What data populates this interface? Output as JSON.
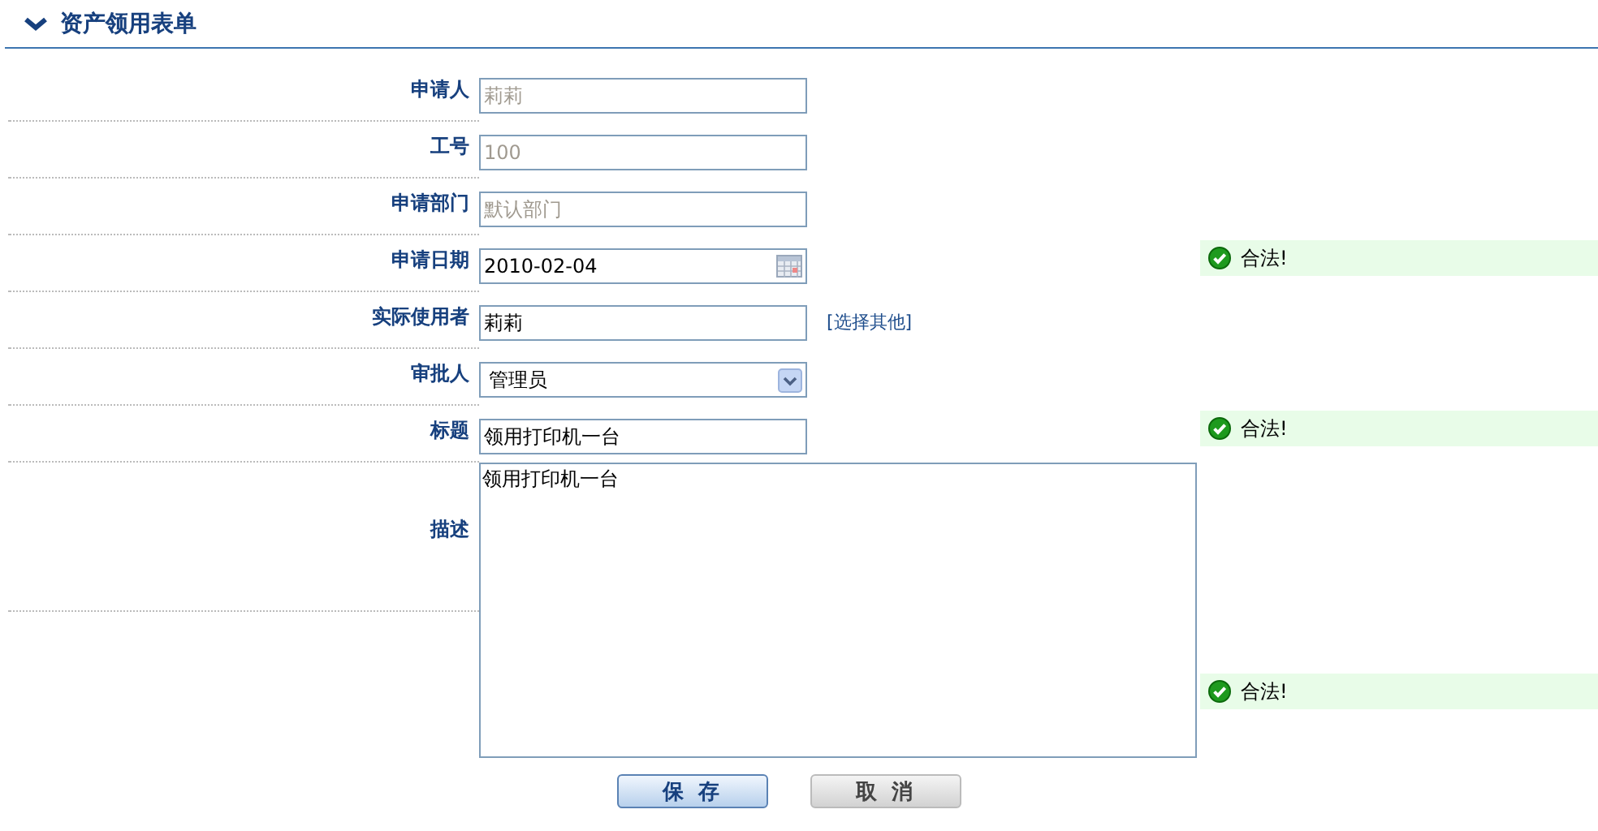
{
  "header": {
    "title": "资产领用表单"
  },
  "fields": [
    {
      "label": "申请人",
      "kind": "input",
      "value": "莉莉",
      "disabled": true
    },
    {
      "label": "工号",
      "kind": "input",
      "value": "100",
      "disabled": true
    },
    {
      "label": "申请部门",
      "kind": "input",
      "value": "默认部门",
      "disabled": true
    },
    {
      "label": "申请日期",
      "kind": "date",
      "value": "2010-02-04",
      "disabled": false,
      "message": "合法!"
    },
    {
      "label": "实际使用者",
      "kind": "input",
      "value": "莉莉",
      "disabled": false,
      "link": "[选择其他]"
    },
    {
      "label": "审批人",
      "kind": "select",
      "value": "管理员",
      "disabled": false
    },
    {
      "label": "标题",
      "kind": "input",
      "value": "领用打印机一台",
      "disabled": false,
      "message": "合法!"
    },
    {
      "label": "描述",
      "kind": "textarea",
      "value": "领用打印机一台",
      "disabled": false,
      "message": "合法!"
    }
  ],
  "buttons": [
    {
      "label": "保 存",
      "kind": "primary"
    },
    {
      "label": "取 消",
      "kind": "secondary"
    }
  ]
}
